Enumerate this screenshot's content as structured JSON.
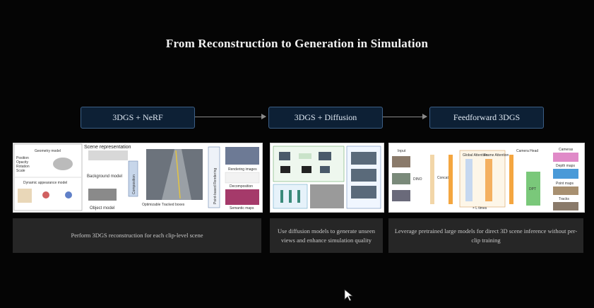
{
  "title": "From Reconstruction to Generation in Simulation",
  "stages": [
    {
      "label": "3DGS + NeRF"
    },
    {
      "label": "3DGS + Diffusion"
    },
    {
      "label": "Feedforward 3DGS"
    }
  ],
  "descriptions": [
    "Perform 3DGS reconstruction for each clip-level scene",
    "Use diffusion models to generate unseen views and enhance simulation quality",
    "Leverage pretrained large models for direct 3D scene inference without per-clip training"
  ],
  "figure1": {
    "scene_representation": "Scene representation",
    "geometry_model": "Geometry model",
    "geometry_params": [
      "Position",
      "Opacity",
      "Rotation",
      "Scale"
    ],
    "dynamic_appearance": "Dynamic appearance model",
    "background_model": "Background model",
    "object_model": "Object model",
    "composition": "Composition",
    "tracked_boxes": "Optimizable Tracked boxes",
    "point_rendering": "Point-based Rendering",
    "rendering_images": "Rendering images",
    "decomposition": "Decomposition",
    "semantic_maps": "Semantic maps"
  },
  "figure3": {
    "input": "Input",
    "dino": "DINO",
    "concat": "Concat",
    "global_attention": "Global Attention",
    "frame_attention": "Frame Attention",
    "times": "× L times",
    "camera_head": "Camera Head",
    "dpt": "DPT",
    "outputs": [
      "Cameras",
      "Depth maps",
      "Point maps",
      "Tracks"
    ]
  }
}
